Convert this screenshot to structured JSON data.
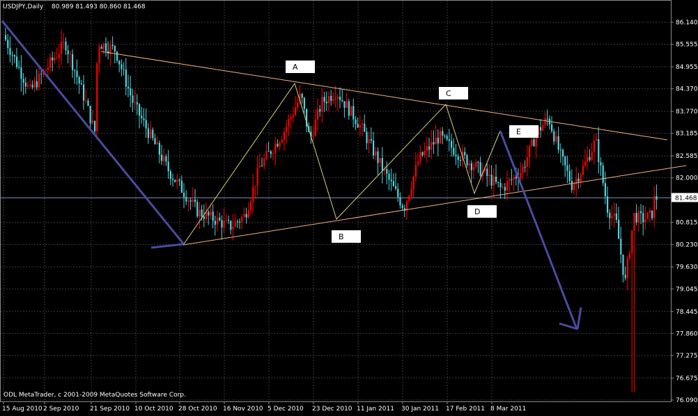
{
  "header": {
    "symbol": "USDJPY,Daily",
    "ohlc": "80.989 81.493 80.860 81.468"
  },
  "footer": {
    "copyright": "ODL MetaTrader, c 2001-2009 MetaQuotes Software Corp."
  },
  "chart_data": {
    "type": "candlestick",
    "y_axis": {
      "ticks": [
        "86.140",
        "85.555",
        "84.955",
        "84.370",
        "83.770",
        "83.185",
        "82.585",
        "82.000",
        "81.468",
        "80.815",
        "80.230",
        "79.630",
        "79.045",
        "78.445",
        "77.860",
        "77.275",
        "76.675",
        "76.090"
      ],
      "current_price": "81.468",
      "ylim": [
        76.09,
        86.14
      ]
    },
    "x_axis": {
      "ticks": [
        "15 Aug 2010",
        "2 Sep 2010",
        "21 Sep 2010",
        "10 Oct 2010",
        "28 Oct 2010",
        "16 Nov 2010",
        "5 Dec 2010",
        "23 Dec 2010",
        "11 Jan 2011",
        "30 Jan 2011",
        "17 Feb 2011",
        "8 Mar 2011"
      ]
    },
    "colors": {
      "bull": "#ff0000",
      "bear": "#4fd6e0",
      "trendline": "#f4b183",
      "wave": "#d9d27a",
      "arrow": "#4b4ba0",
      "grid": "#3a3a3a",
      "current_line": "#7c8fb0"
    },
    "wave_points": [
      {
        "label": "A",
        "date": "2010-12-06",
        "price": 84.5
      },
      {
        "label": "B",
        "date": "2010-12-29",
        "price": 80.9
      },
      {
        "label": "C",
        "date": "2011-02-16",
        "price": 83.9
      },
      {
        "label": "D",
        "date": "2011-02-22",
        "price": 81.6
      },
      {
        "label": "E",
        "date": "2011-03-05",
        "price": 83.3
      }
    ]
  }
}
